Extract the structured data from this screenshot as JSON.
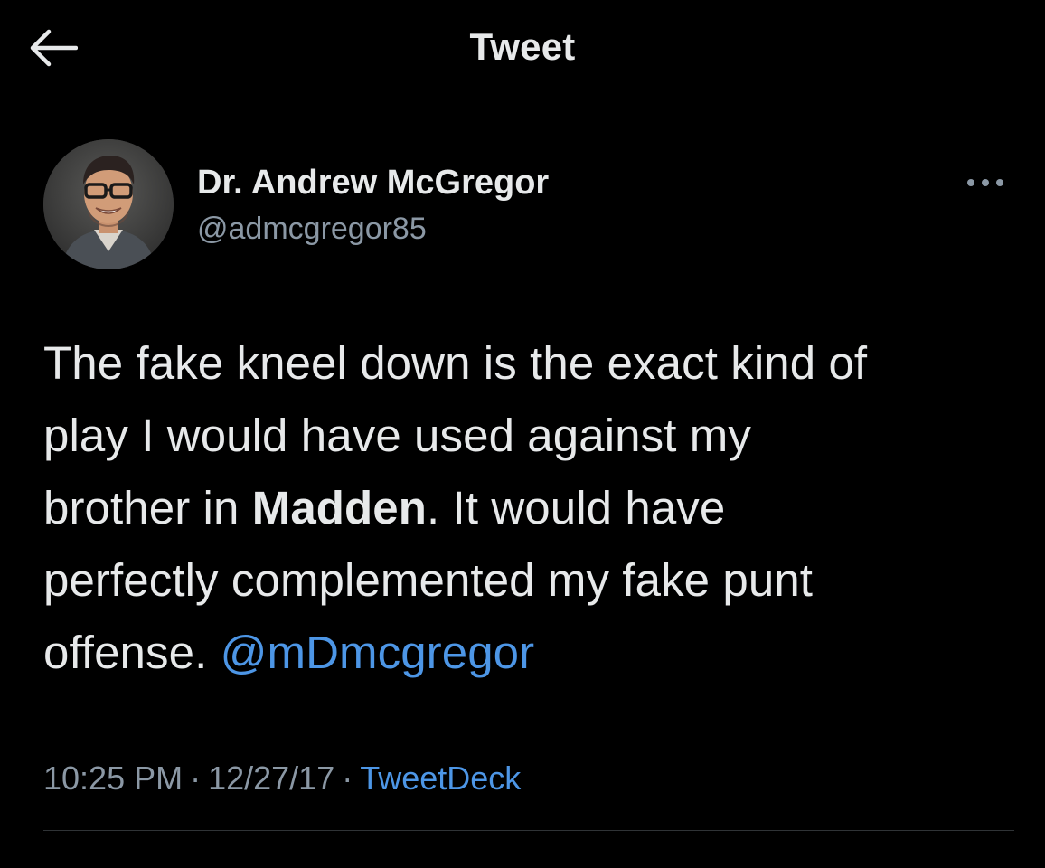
{
  "header": {
    "title": "Tweet",
    "back_icon": "arrow-left-icon"
  },
  "author": {
    "display_name": "Dr. Andrew McGregor",
    "handle": "@admcgregor85",
    "more_icon": "more-horizontal-icon"
  },
  "tweet": {
    "line1": "The fake kneel down is the exact kind of",
    "line2": "play I would have used against my",
    "line3_pre": "brother in ",
    "line3_bold": "Madden",
    "line3_post": ". It would have",
    "line4": "perfectly complemented my fake punt",
    "line5_pre": "offense. ",
    "mention": "@mDmcgregor"
  },
  "meta": {
    "time": "10:25 PM",
    "sep1": "·",
    "date": "12/27/17",
    "sep2": "·",
    "source": "TweetDeck"
  },
  "colors": {
    "background": "#000000",
    "text": "#e7e9ea",
    "secondary_text": "#8b98a5",
    "link": "#4d96e6",
    "divider": "#2f3336"
  }
}
